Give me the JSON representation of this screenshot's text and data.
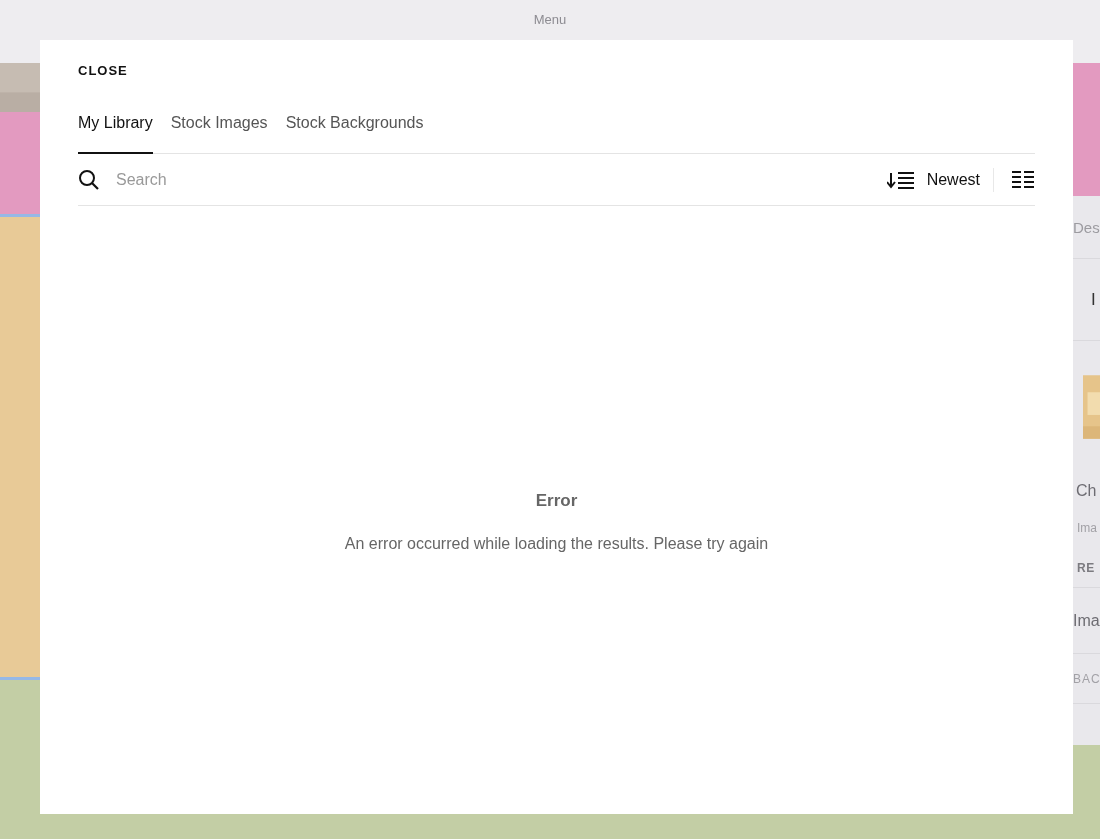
{
  "top_bar": {
    "title": "Menu"
  },
  "background_page": {
    "side_panel": [
      {
        "kind": "label",
        "text": "Des"
      },
      {
        "kind": "tab",
        "text": "I"
      },
      {
        "kind": "thumbnail"
      },
      {
        "kind": "title",
        "text": "Ch"
      },
      {
        "kind": "caption",
        "text": "Ima"
      },
      {
        "kind": "action",
        "text": "RE"
      },
      {
        "kind": "field",
        "text": "Ima"
      },
      {
        "kind": "section",
        "text": "BAC"
      }
    ]
  },
  "modal": {
    "close_label": "CLOSE",
    "tabs": [
      {
        "label": "My Library",
        "selected": true
      },
      {
        "label": "Stock Images",
        "selected": false
      },
      {
        "label": "Stock Backgrounds",
        "selected": false
      }
    ],
    "search": {
      "placeholder": "Search"
    },
    "sort": {
      "label": "Newest"
    },
    "error": {
      "title": "Error",
      "message": "An error occurred while loading the results. Please try again"
    }
  }
}
